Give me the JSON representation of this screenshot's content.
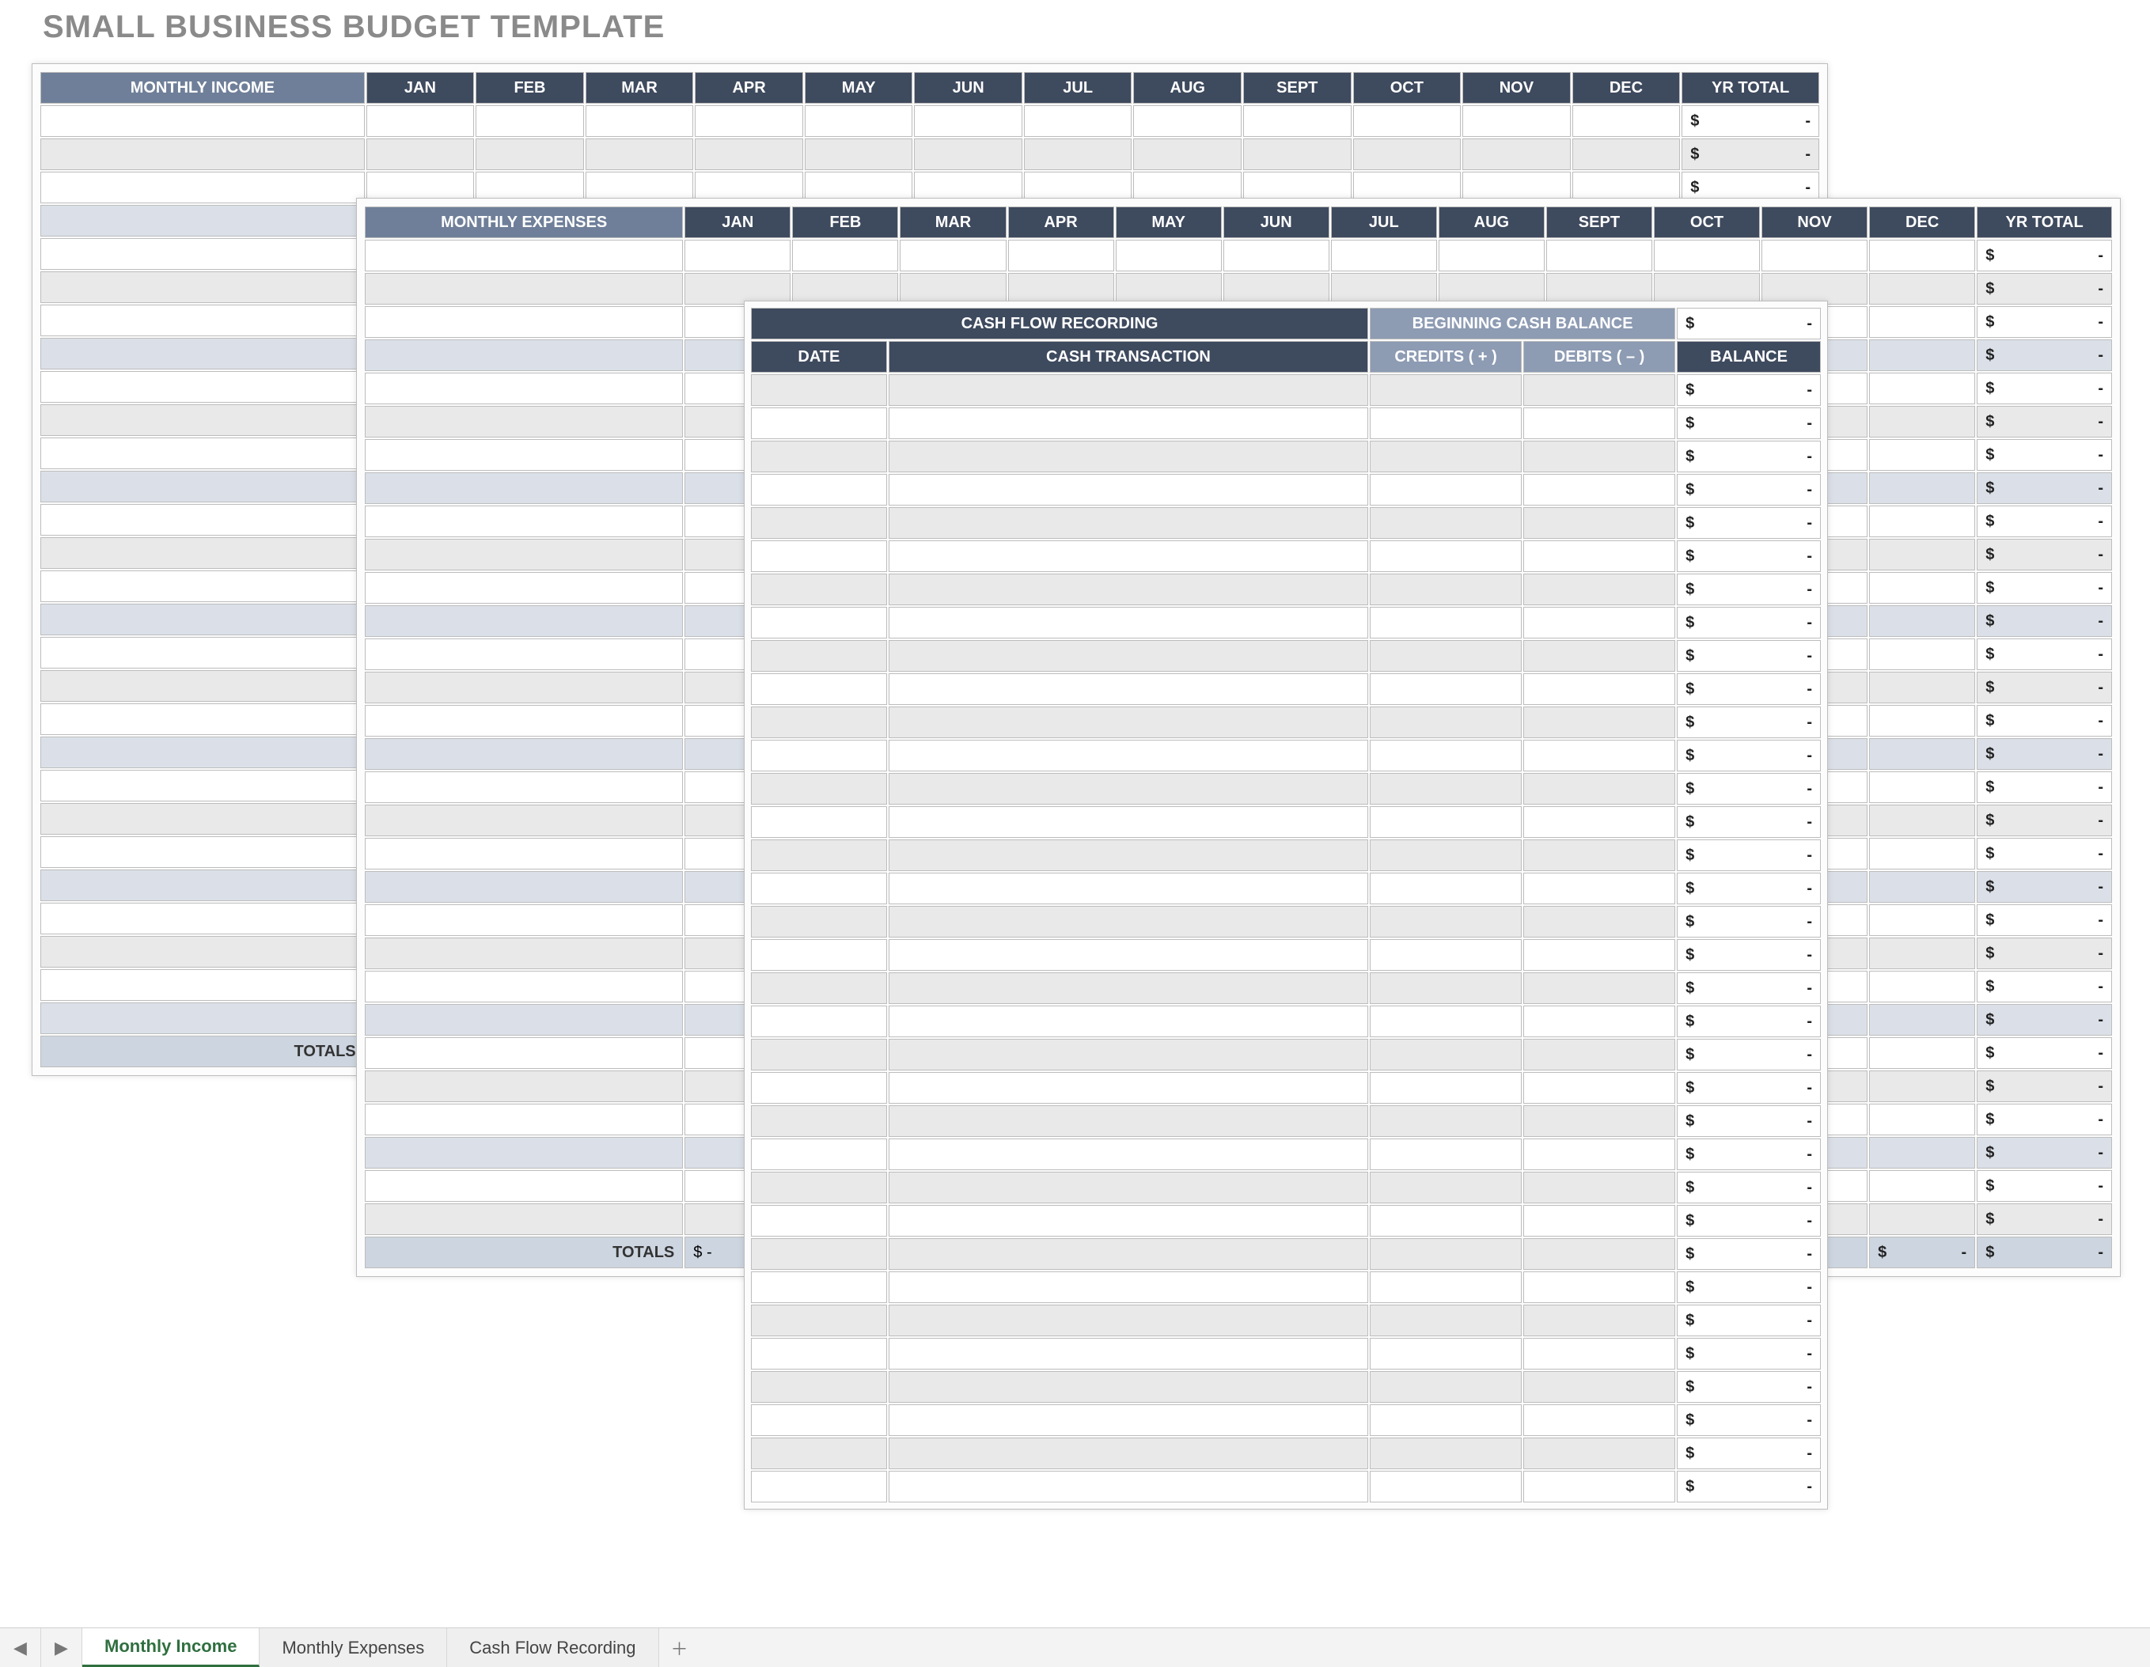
{
  "title": "SMALL BUSINESS BUDGET TEMPLATE",
  "months": [
    "JAN",
    "FEB",
    "MAR",
    "APR",
    "MAY",
    "JUN",
    "JUL",
    "AUG",
    "SEPT",
    "OCT",
    "NOV",
    "DEC"
  ],
  "yr_total_label": "YR TOTAL",
  "income": {
    "header_label": "MONTHLY INCOME",
    "totals_label": "TOTALS",
    "row_count": 28,
    "first_totals_value": "$",
    "yr_total_display": {
      "currency": "$",
      "value": "-"
    }
  },
  "expenses": {
    "header_label": "MONTHLY EXPENSES",
    "totals_label": "TOTALS",
    "row_count": 30,
    "first_totals_value": "$          -",
    "yr_total_display": {
      "currency": "$",
      "value": "-"
    },
    "totals_yr_display": {
      "currency": "$",
      "value": "-"
    }
  },
  "cashflow": {
    "title": "CASH FLOW RECORDING",
    "beginning_label": "BEGINNING CASH BALANCE",
    "beginning_display": {
      "currency": "$",
      "value": "-"
    },
    "col_date": "DATE",
    "col_txn": "CASH TRANSACTION",
    "col_credits": "CREDITS ( + )",
    "col_debits": "DEBITS ( – )",
    "col_balance": "BALANCE",
    "row_count": 34,
    "balance_display": {
      "currency": "$",
      "value": "-"
    }
  },
  "tabs": {
    "items": [
      "Monthly Income",
      "Monthly Expenses",
      "Cash Flow Recording"
    ],
    "active_index": 0
  }
}
